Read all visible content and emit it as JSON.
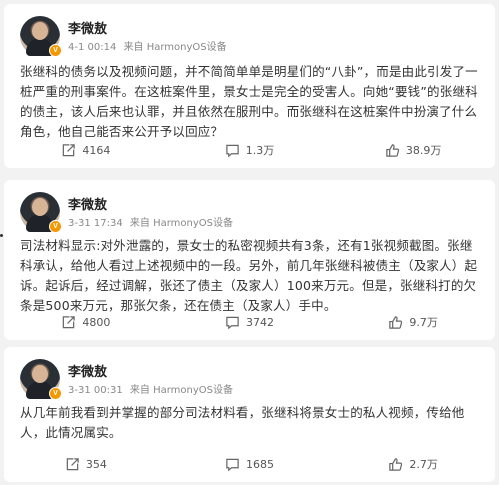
{
  "posts": [
    {
      "author": "李微敖",
      "time": "4-1 00:14",
      "source": "来自 HarmonyOS设备",
      "text": "张继科的债务以及视频问题，并不简简单单是明星们的“八卦”，而是由此引发了一桩严重的刑事案件。在这桩案件里，景女士是完全的受害人。向她“要钱”的张继科的债主，该人后来也认罪，并且依然在服刑中。而张继科在这桩案件中扮演了什么角色，他自己能否来公开予以回应？",
      "repost": "4164",
      "comment": "1.3万",
      "like": "38.9万"
    },
    {
      "author": "李微敖",
      "time": "3-31 17:34",
      "source": "来自 HarmonyOS设备",
      "text": "司法材料显示:对外泄露的，景女士的私密视频共有3条，还有1张视频截图。张继科承认，给他人看过上述视频中的一段。另外，前几年张继科被债主（及家人）起诉。起诉后，经过调解，张还了债主（及家人）100来万元。但是，张继科打的欠条是500来万元，那张欠条，还在债主（及家人）手中。",
      "repost": "4800",
      "comment": "3742",
      "like": "9.7万"
    },
    {
      "author": "李微敖",
      "time": "3-31 00:31",
      "source": "来自 HarmonyOS设备",
      "text": "从几年前我看到并掌握的部分司法材料看，张继科将景女士的私人视频，传给他人，此情况属实。",
      "repost": "354",
      "comment": "1685",
      "like": "2.7万"
    }
  ],
  "icons": {
    "repost": "repost-icon",
    "comment": "comment-icon",
    "like": "like-icon",
    "verified": "verified-badge"
  },
  "verified_mark": "V",
  "colors": {
    "verified": "#f39800",
    "background": "#f2f2f2",
    "card": "#ffffff",
    "meta": "#888888"
  }
}
